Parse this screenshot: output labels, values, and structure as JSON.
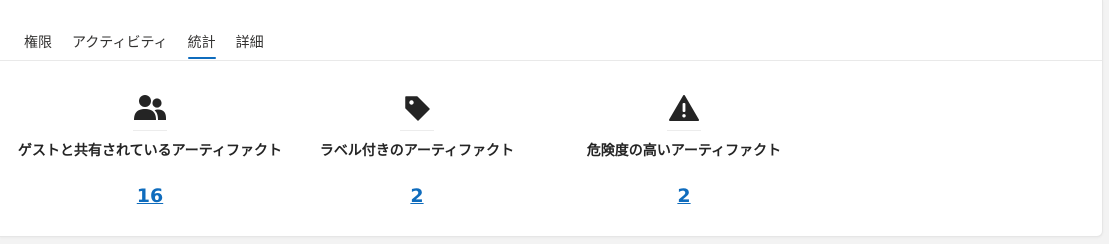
{
  "tabs": [
    {
      "label": "権限",
      "active": false
    },
    {
      "label": "アクティビティ",
      "active": false
    },
    {
      "label": "統計",
      "active": true
    },
    {
      "label": "詳細",
      "active": false
    }
  ],
  "stats": [
    {
      "icon": "people-icon",
      "label": "ゲストと共有されているアーティファクト",
      "value": "16"
    },
    {
      "icon": "tag-icon",
      "label": "ラベル付きのアーティファクト",
      "value": "2"
    },
    {
      "icon": "warning-icon",
      "label": "危険度の高いアーティファクト",
      "value": "2"
    }
  ],
  "colors": {
    "accent": "#0f6cbd",
    "text": "#242424",
    "icon": "#242424"
  }
}
